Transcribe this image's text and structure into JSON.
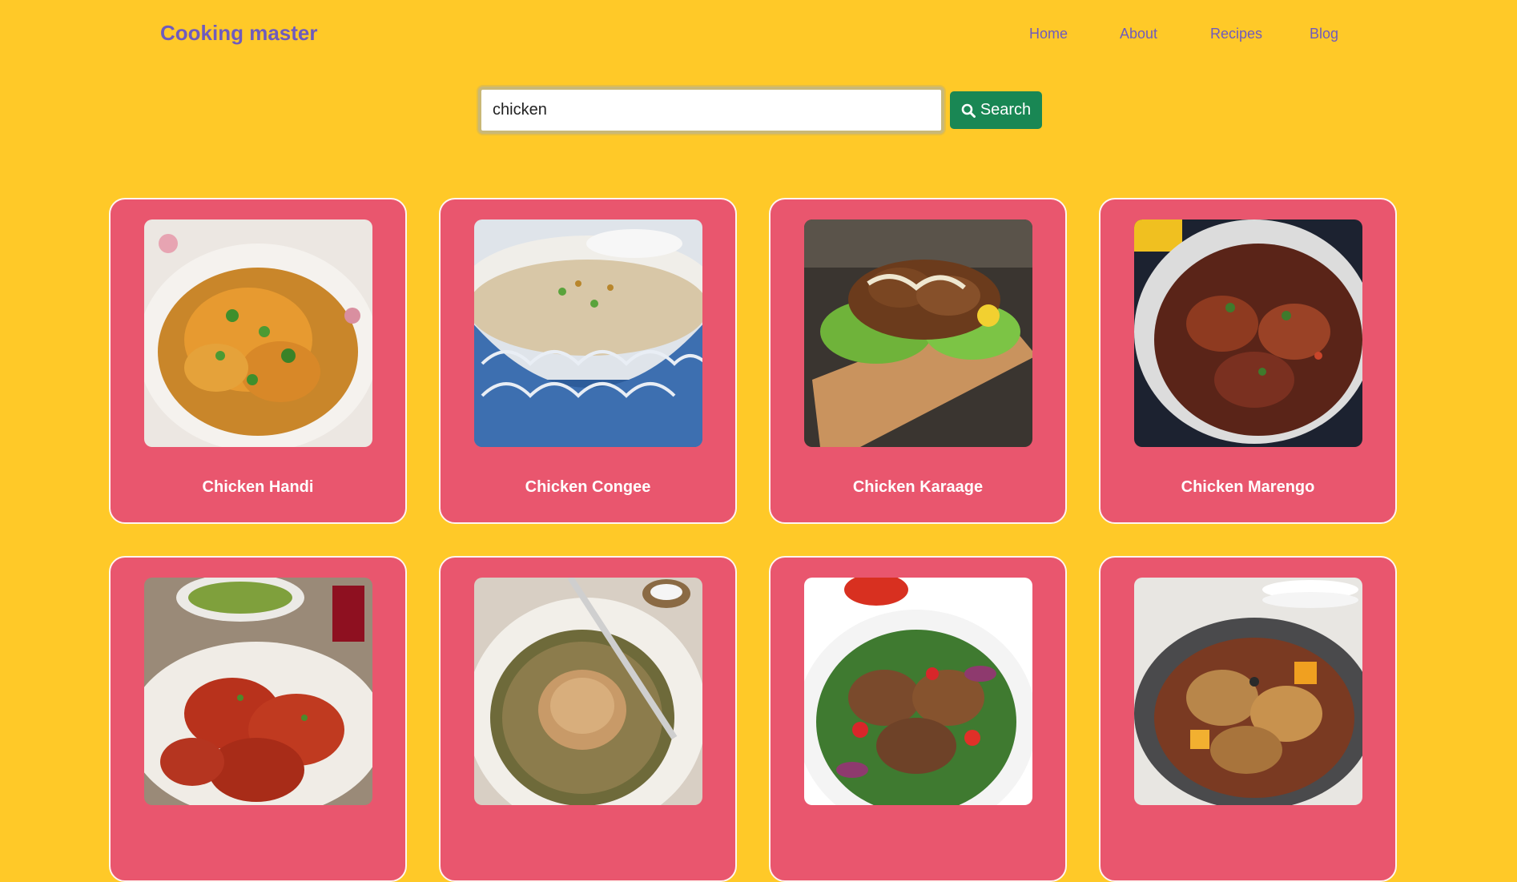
{
  "navbar": {
    "brand": "Cooking master",
    "links": [
      "Home",
      "About",
      "Recipes",
      "Blog"
    ]
  },
  "search": {
    "value": "chicken",
    "button_label": "Search"
  },
  "colors": {
    "background": "#ffc928",
    "card": "#e9566e",
    "brand": "#6f5bbd",
    "search_button": "#198754"
  },
  "recipes": [
    {
      "title": "Chicken Handi"
    },
    {
      "title": "Chicken Congee"
    },
    {
      "title": "Chicken Karaage"
    },
    {
      "title": "Chicken Marengo"
    },
    {
      "title": ""
    },
    {
      "title": ""
    },
    {
      "title": ""
    },
    {
      "title": ""
    }
  ]
}
